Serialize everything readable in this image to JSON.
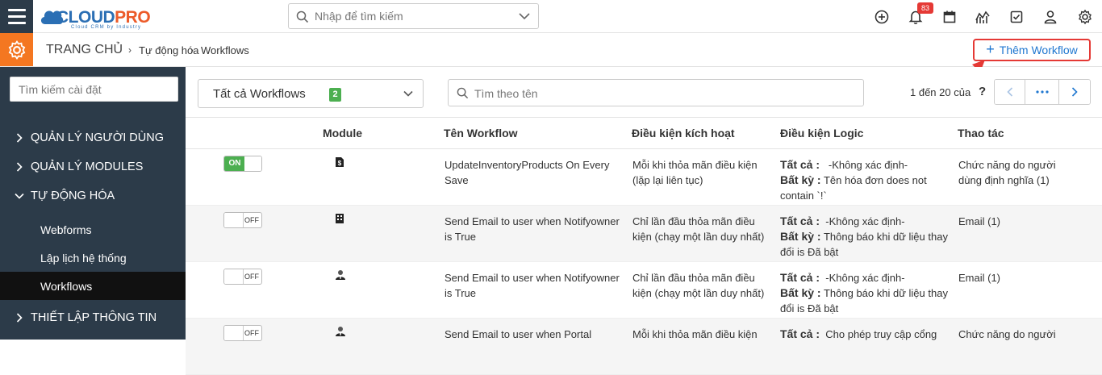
{
  "topbar": {
    "logo_text_a": "CLOUD",
    "logo_text_b": "PRO",
    "logo_tagline": "Cloud CRM by Industry",
    "search_placeholder": "Nhập để tìm kiếm",
    "notification_count": "83",
    "icons": [
      "plus-circle-icon",
      "bell-icon",
      "calendar-icon",
      "chart-icon",
      "checkbox-icon",
      "user-icon",
      "gear-icon"
    ]
  },
  "breadcrumb": {
    "home": "TRANG CHỦ",
    "level1": "Tự động hóa",
    "level2": "Workflows"
  },
  "add_button": {
    "label": "Thêm Workflow"
  },
  "sidebar": {
    "search_placeholder": "Tìm kiếm cài đặt",
    "items": [
      {
        "label": "QUẢN LÝ NGƯỜI DÙNG",
        "expanded": false
      },
      {
        "label": "QUẢN LÝ MODULES",
        "expanded": false
      },
      {
        "label": "TỰ ĐỘNG HÓA",
        "expanded": true
      },
      {
        "label": "THIẾT LẬP THÔNG TIN",
        "expanded": false
      }
    ],
    "subitems": [
      {
        "label": "Webforms",
        "active": false
      },
      {
        "label": "Lập lịch hệ thống",
        "active": false
      },
      {
        "label": "Workflows",
        "active": true
      }
    ]
  },
  "filter": {
    "label": "Tất cả Workflows",
    "count": "2"
  },
  "name_search": {
    "placeholder": "Tìm theo tên"
  },
  "paging": {
    "text": "1 đến 20 của",
    "help": "?"
  },
  "table": {
    "headers": [
      "Module",
      "Tên Workflow",
      "Điều kiện kích hoạt",
      "Điều kiện Logic",
      "Thao tác"
    ],
    "rows": [
      {
        "status": "ON",
        "module_icon": "invoice-icon",
        "name": "UpdateInventoryProducts On Every Save",
        "trigger": "Mỗi khi thỏa mãn điều kiện (lặp lại liên tục)",
        "logic_all_label": "Tất cả :",
        "logic_all": "-Không xác định-",
        "logic_any_label": "Bất kỳ :",
        "logic_any": "Tên hóa đơn does not contain `!`",
        "action": "Chức năng do người dùng định nghĩa (1)"
      },
      {
        "status": "OFF",
        "module_icon": "building-icon",
        "name": "Send Email to user when Notifyowner is True",
        "trigger": "Chỉ lần đầu thỏa mãn điều kiện (chạy một lần duy nhất)",
        "logic_all_label": "Tất cả :",
        "logic_all": "-Không xác định-",
        "logic_any_label": "Bất kỳ :",
        "logic_any": "Thông báo khi dữ liệu thay đổi is Đã bật",
        "action": "Email (1)"
      },
      {
        "status": "OFF",
        "module_icon": "contact-person-icon",
        "name": "Send Email to user when Notifyowner is True",
        "trigger": "Chỉ lần đầu thỏa mãn điều kiện (chạy một lần duy nhất)",
        "logic_all_label": "Tất cả :",
        "logic_all": "-Không xác định-",
        "logic_any_label": "Bất kỳ :",
        "logic_any": "Thông báo khi dữ liệu thay đổi is Đã bật",
        "action": "Email (1)"
      },
      {
        "status": "OFF",
        "module_icon": "contact-person-icon",
        "name": "Send Email to user when Portal",
        "trigger": "Mỗi khi thỏa mãn điều kiện",
        "logic_all_label": "Tất cả :",
        "logic_all": "Cho phép truy cập cổng",
        "logic_any_label": "",
        "logic_any": "",
        "action": "Chức năng do người"
      }
    ]
  },
  "colors": {
    "sidebar_bg": "#2c3b49",
    "accent_orange": "#f47721",
    "link_blue": "#1f77d0",
    "highlight_red": "#e53935",
    "toggle_on": "#4caf50"
  }
}
